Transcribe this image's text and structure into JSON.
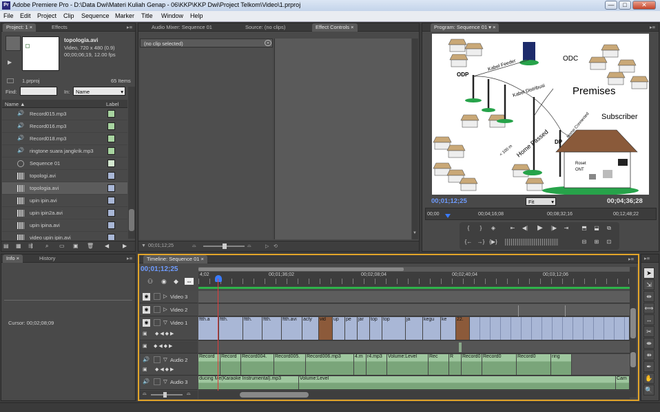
{
  "window": {
    "title": "Adobe Premiere Pro - D:\\Data Dwi\\Materi Kuliah Genap - 06\\KKP\\KKP Dwi\\Project Telkom\\Video\\1.prproj",
    "app_icon_text": "Pr"
  },
  "menu": [
    "File",
    "Edit",
    "Project",
    "Clip",
    "Sequence",
    "Marker",
    "Title",
    "Window",
    "Help"
  ],
  "project_panel": {
    "tabs": [
      "Project: 1",
      "Effects"
    ],
    "clip_name": "topologia.avi",
    "clip_info1": "Video, 720 x 480 (0.9)",
    "clip_info2": "00;00;06;19, 12.00 fps",
    "project_file": "1.prproj",
    "item_count": "65 Items",
    "find_label": "Find:",
    "in_label": "In:",
    "in_value": "Name",
    "col_name": "Name",
    "col_label": "Label",
    "items": [
      {
        "name": "Record015.mp3",
        "type": "audio",
        "color": "#a8d4a0"
      },
      {
        "name": "Record016.mp3",
        "type": "audio",
        "color": "#a8d4a0"
      },
      {
        "name": "Record018.mp3",
        "type": "audio",
        "color": "#a8d4a0"
      },
      {
        "name": "ringtone suara jangkrik.mp3",
        "type": "audio",
        "color": "#a8d4a0"
      },
      {
        "name": "Sequence 01",
        "type": "sequence",
        "color": "#d4e8d0"
      },
      {
        "name": "topologi.avi",
        "type": "video",
        "color": "#a9b7d6"
      },
      {
        "name": "topologia.avi",
        "type": "video",
        "color": "#a9b7d6"
      },
      {
        "name": "upin ipin.avi",
        "type": "video",
        "color": "#a9b7d6"
      },
      {
        "name": "upin ipin2a.avi",
        "type": "video",
        "color": "#a9b7d6"
      },
      {
        "name": "upin ipina.avi",
        "type": "video",
        "color": "#a9b7d6"
      },
      {
        "name": "video upin ipin.avi",
        "type": "video",
        "color": "#a9b7d6"
      }
    ]
  },
  "effect_controls": {
    "tabs": [
      "Audio Mixer: Sequence 01",
      "Source: (no clips)",
      "Effect Controls"
    ],
    "no_clip": "(no clip selected)",
    "timecode": "00;01;12;25"
  },
  "program_monitor": {
    "tab": "Program: Sequence 01",
    "timecode_current": "00;01;12;25",
    "fit_value": "Fit",
    "timecode_duration": "00;04;36;28",
    "ruler_labels": [
      "00;00",
      "00;04;16;08",
      "00;08;32;16",
      "00;12;48;22"
    ],
    "diagram": {
      "odc": "ODC",
      "odp": "ODP",
      "kabel_feeder": "Kabel Feeder",
      "kabel_distribusi": "Kabel Distribusi",
      "premises": "Premises",
      "subscriber": "Subscriber",
      "home_passed": "Home Passed",
      "dp": "DP",
      "home_connected": "Home Connected",
      "distance": "< 100 m",
      "roset": "Roset",
      "ont": "ONT"
    }
  },
  "info_panel": {
    "tabs": [
      "Info",
      "History"
    ],
    "cursor": "Cursor:  00;02;08;09"
  },
  "timeline": {
    "tab": "Timeline: Sequence 01",
    "timecode": "00;01;12;25",
    "ruler": [
      "4;02",
      "00;01;36;02",
      "00;02;08;04",
      "00;02;40;04",
      "00;03;12;06"
    ],
    "tracks": {
      "video3": "Video 3",
      "video2": "Video 2",
      "video1": "Video 1",
      "audio2": "Audio 2",
      "audio3": "Audio 3"
    },
    "video1_clips": [
      "ftth.a",
      "ftth.",
      "ftth.",
      "ftth.",
      "ftth.avi",
      "acty",
      "vid",
      "up",
      "pe",
      "jar",
      "top",
      "top",
      "ja",
      "kegu",
      "ke",
      "22."
    ],
    "audio2_clips": [
      "Record",
      "Record",
      "Record004.",
      "Record005.",
      "Record006.mp3",
      "4.m",
      "r4.mp3",
      "Volume:Level",
      "Rec",
      "R",
      "Record0",
      "Record0",
      "Record0",
      "ring"
    ],
    "audio3_clips": [
      "ducing Me(Karaoke Instrumental).mp3",
      "Volume:Level",
      "Cam"
    ]
  }
}
